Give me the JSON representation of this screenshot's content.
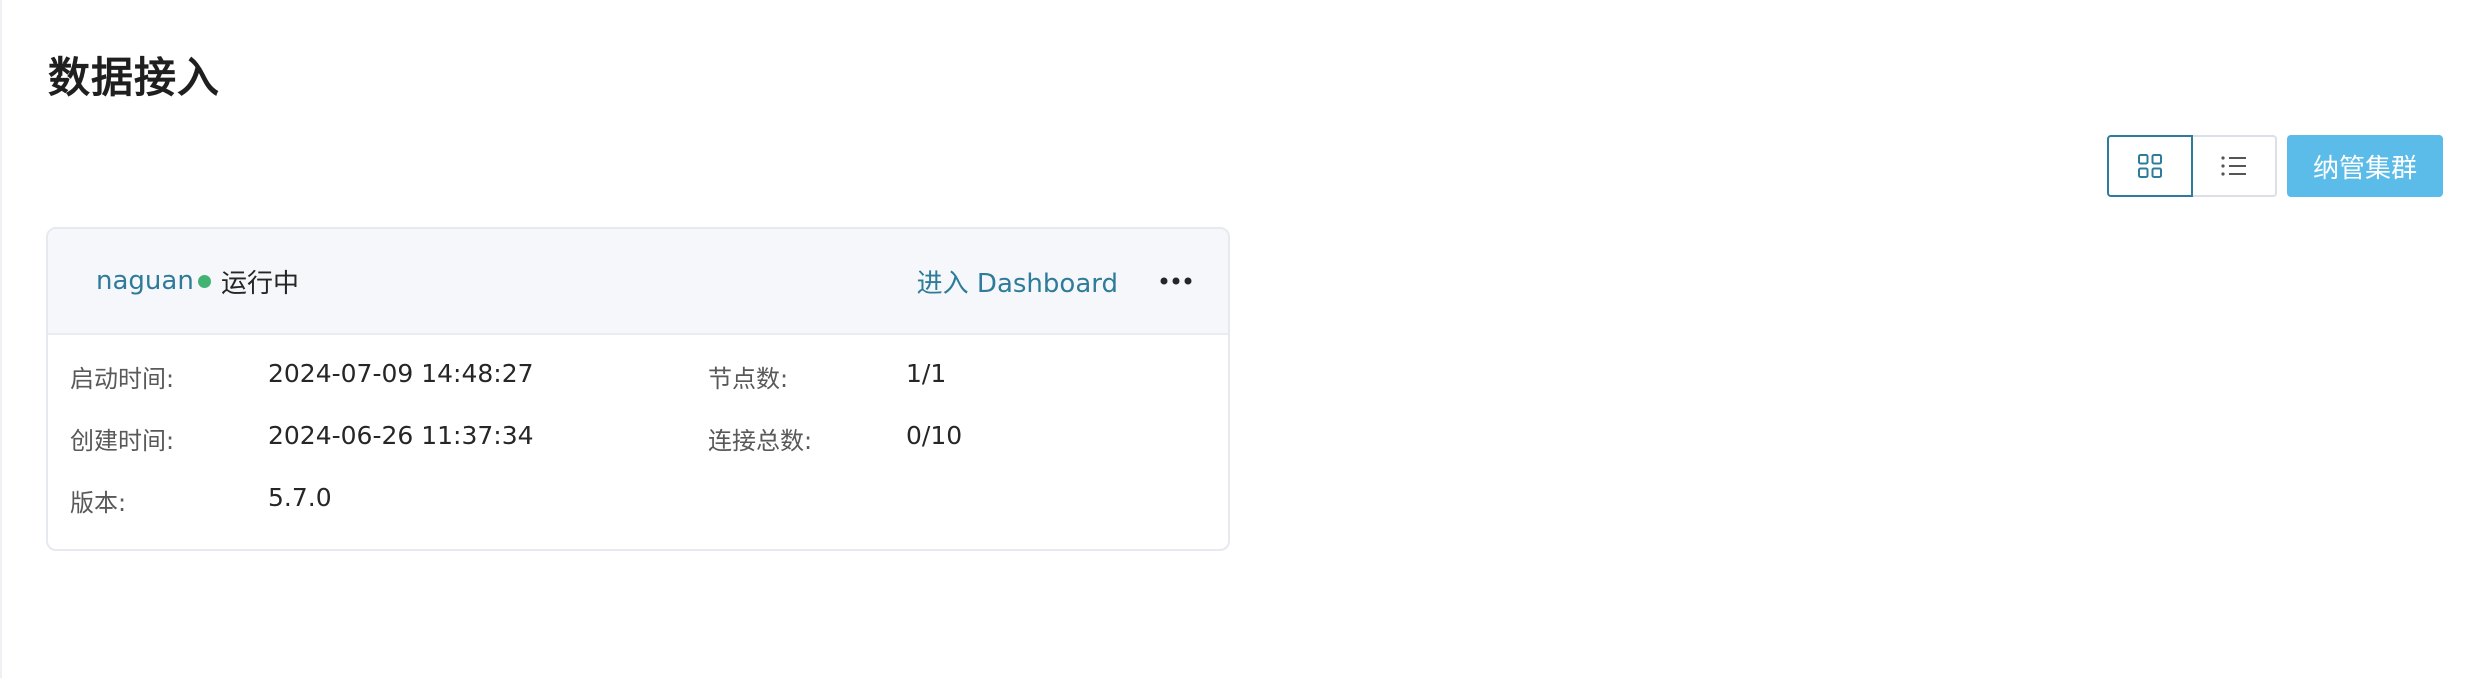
{
  "page": {
    "title": "数据接入"
  },
  "toolbar": {
    "grid_view_icon": "grid-icon",
    "list_view_icon": "list-icon",
    "add_cluster_label": "纳管集群",
    "accent_color": "#2e7c9a",
    "primary_button_color": "#5cbce9"
  },
  "cluster_card": {
    "name": "naguan",
    "status": "运行中",
    "status_color": "#43b374",
    "dashboard_link": "进入 Dashboard",
    "more_icon": "more-horizontal-icon",
    "fields": {
      "start_time_label": "启动时间:",
      "start_time_value": "2024-07-09 14:48:27",
      "created_time_label": "创建时间:",
      "created_time_value": "2024-06-26 11:37:34",
      "version_label": "版本:",
      "version_value": "5.7.0",
      "nodes_label": "节点数:",
      "nodes_value": "1/1",
      "connections_label": "连接总数:",
      "connections_value": "0/10"
    }
  }
}
